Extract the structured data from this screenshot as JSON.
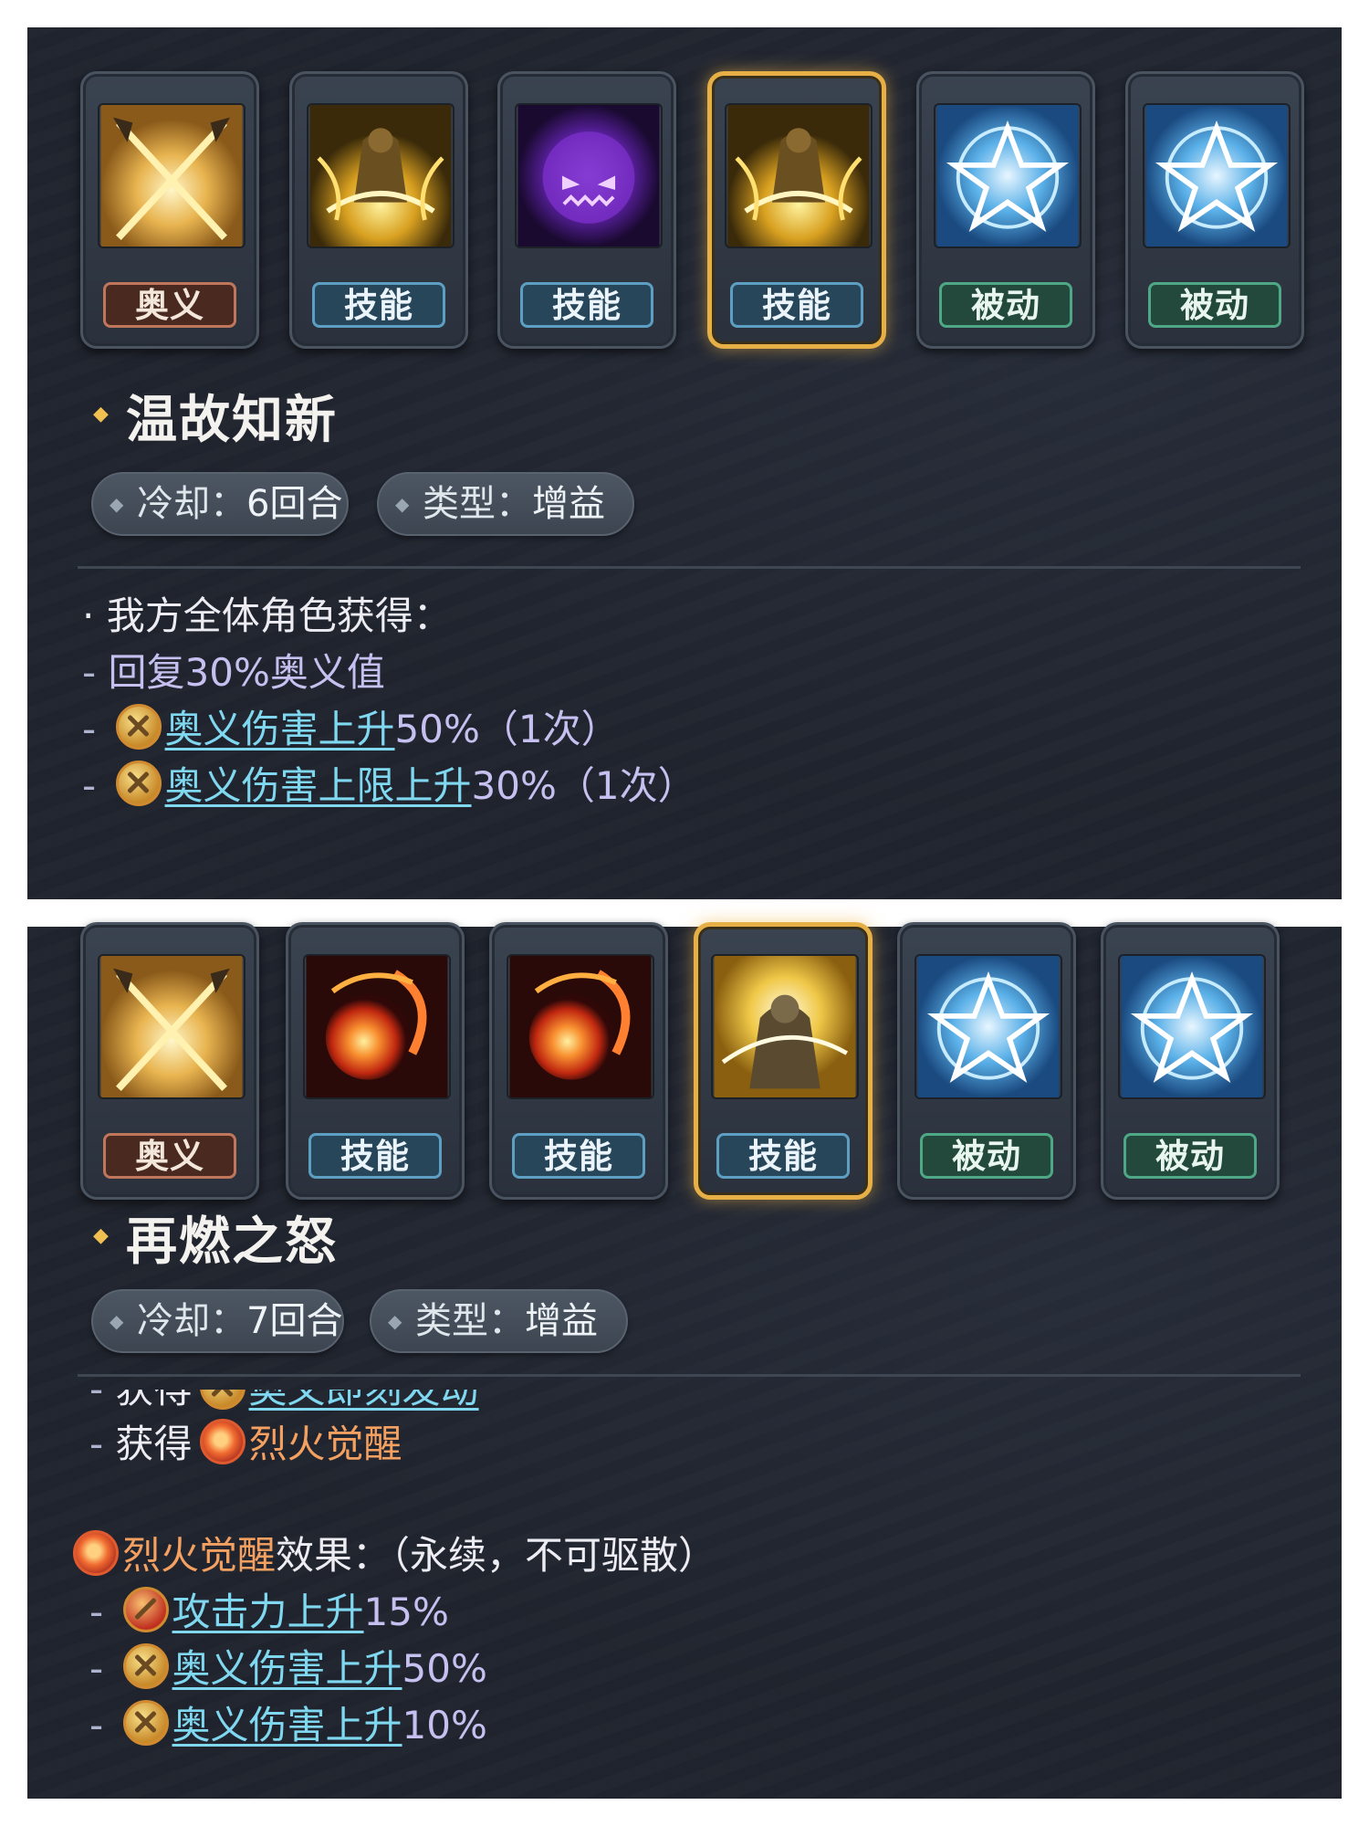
{
  "panels": [
    {
      "skills": [
        {
          "label": "奥义",
          "kind": "ougi",
          "icon": "crossed-swords-icon"
        },
        {
          "label": "技能",
          "kind": "skill",
          "icon": "golden-warrior-icon"
        },
        {
          "label": "技能",
          "kind": "skill",
          "icon": "purple-demon-icon"
        },
        {
          "label": "技能",
          "kind": "skill",
          "icon": "golden-warrior-icon",
          "selected": true
        },
        {
          "label": "被动",
          "kind": "passive",
          "icon": "blue-star-icon"
        },
        {
          "label": "被动",
          "kind": "passive",
          "icon": "blue-star-icon"
        }
      ],
      "title": "温故知新",
      "cooldown_label": "冷却：",
      "cooldown_value": "6回合",
      "type_label": "类型：",
      "type_value": "增益",
      "desc": {
        "l1": "我方全体角色获得：",
        "l2": "回复30%奥义值",
        "l3_link": "奥义伤害上升",
        "l3_rest": "50%（1次）",
        "l4_link": "奥义伤害上限上升",
        "l4_rest": "30%（1次）"
      }
    },
    {
      "skills": [
        {
          "label": "奥义",
          "kind": "ougi",
          "icon": "crossed-swords-icon"
        },
        {
          "label": "技能",
          "kind": "skill",
          "icon": "fireball-icon"
        },
        {
          "label": "技能",
          "kind": "skill",
          "icon": "fireball-icon"
        },
        {
          "label": "技能",
          "kind": "skill",
          "icon": "golden-knight-icon",
          "selected": true
        },
        {
          "label": "被动",
          "kind": "passive",
          "icon": "blue-star-icon"
        },
        {
          "label": "被动",
          "kind": "passive",
          "icon": "blue-star-icon"
        }
      ],
      "title": "再燃之怒",
      "cooldown_label": "冷却：",
      "cooldown_value": "7回合",
      "type_label": "类型：",
      "type_value": "增益",
      "desc": {
        "cut_prefix": "获得",
        "cut_link": "奥义即刻发动",
        "l1_prefix": "获得",
        "l1_name": "烈火觉醒",
        "l2_name": "烈火觉醒",
        "l2_rest": "效果：（永续，不可驱散）",
        "l3_link": "攻击力上升",
        "l3_rest": "15%",
        "l4_link": "奥义伤害上升",
        "l4_rest": "50%",
        "l5_link": "奥义伤害上升",
        "l5_rest": "10%"
      }
    }
  ]
}
